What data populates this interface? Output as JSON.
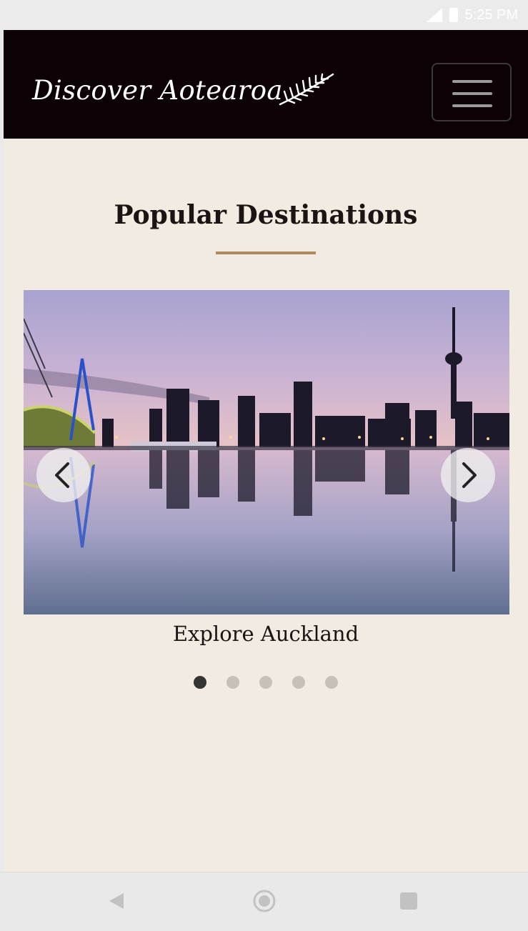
{
  "status_bar": {
    "time": "5:25 PM",
    "icons": [
      "signal-icon",
      "battery-icon"
    ]
  },
  "header": {
    "brand": "Discover Aotearoa",
    "logo_icon": "fern-icon",
    "menu_icon": "hamburger-menu-icon"
  },
  "section": {
    "title": "Popular Destinations"
  },
  "carousel": {
    "current_slide": 1,
    "slide_count": 5,
    "caption": "Explore Auckland",
    "prev_icon": "chevron-left-icon",
    "next_icon": "chevron-right-icon"
  },
  "system_nav": {
    "icons": [
      "back-icon",
      "home-icon",
      "recents-icon"
    ]
  },
  "colors": {
    "navbar_bg": "#0c0104",
    "page_bg": "#f2ebe1",
    "accent_underline": "#b08a5f",
    "indicator_active": "#343434",
    "indicator_inactive": "#c7c0b7"
  }
}
